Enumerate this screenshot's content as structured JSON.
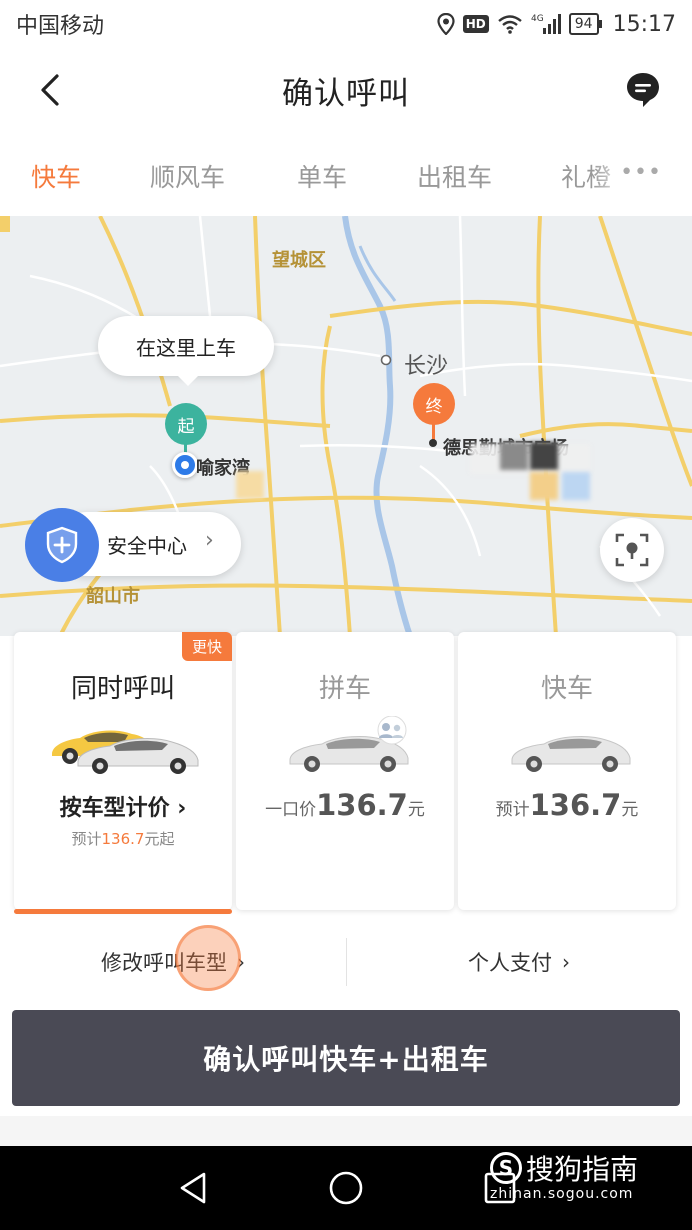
{
  "status_bar": {
    "carrier": "中国移动",
    "network": "4G",
    "battery": "94",
    "time": "15:17"
  },
  "header": {
    "title": "确认呼叫"
  },
  "tabs": [
    "快车",
    "顺风车",
    "单车",
    "出租车",
    "礼橙"
  ],
  "map": {
    "district_label": "望城区",
    "city_label": "长沙",
    "county_label": "韶山市",
    "pickup_bubble": "在这里上车",
    "start_pin": "起",
    "start_place": "喻家湾",
    "end_pin": "终",
    "end_place": "德思勤城市广场",
    "safety_center": "安全中心"
  },
  "cards": [
    {
      "badge": "更快",
      "title": "同时呼叫",
      "price_main": "按车型计价",
      "price_sub_prefix": "预计",
      "price_sub_value": "136.7",
      "price_sub_suffix": "元起"
    },
    {
      "title": "拼车",
      "price_prefix": "一口价",
      "price_value": "136.7",
      "price_unit": "元"
    },
    {
      "title": "快车",
      "price_prefix": "预计",
      "price_value": "136.7",
      "price_unit": "元"
    }
  ],
  "options": {
    "modify_model": "修改呼叫车型",
    "payment": "个人支付"
  },
  "confirm_button": "确认呼叫快车+出租车",
  "watermark": {
    "main": "搜狗指南",
    "sub": "zhinan.sogou.com"
  },
  "colors": {
    "accent": "#f57a3c",
    "start_pin": "#3cb39e",
    "button_bg": "#4a4a55",
    "safety_blue": "#4a7fe6"
  }
}
